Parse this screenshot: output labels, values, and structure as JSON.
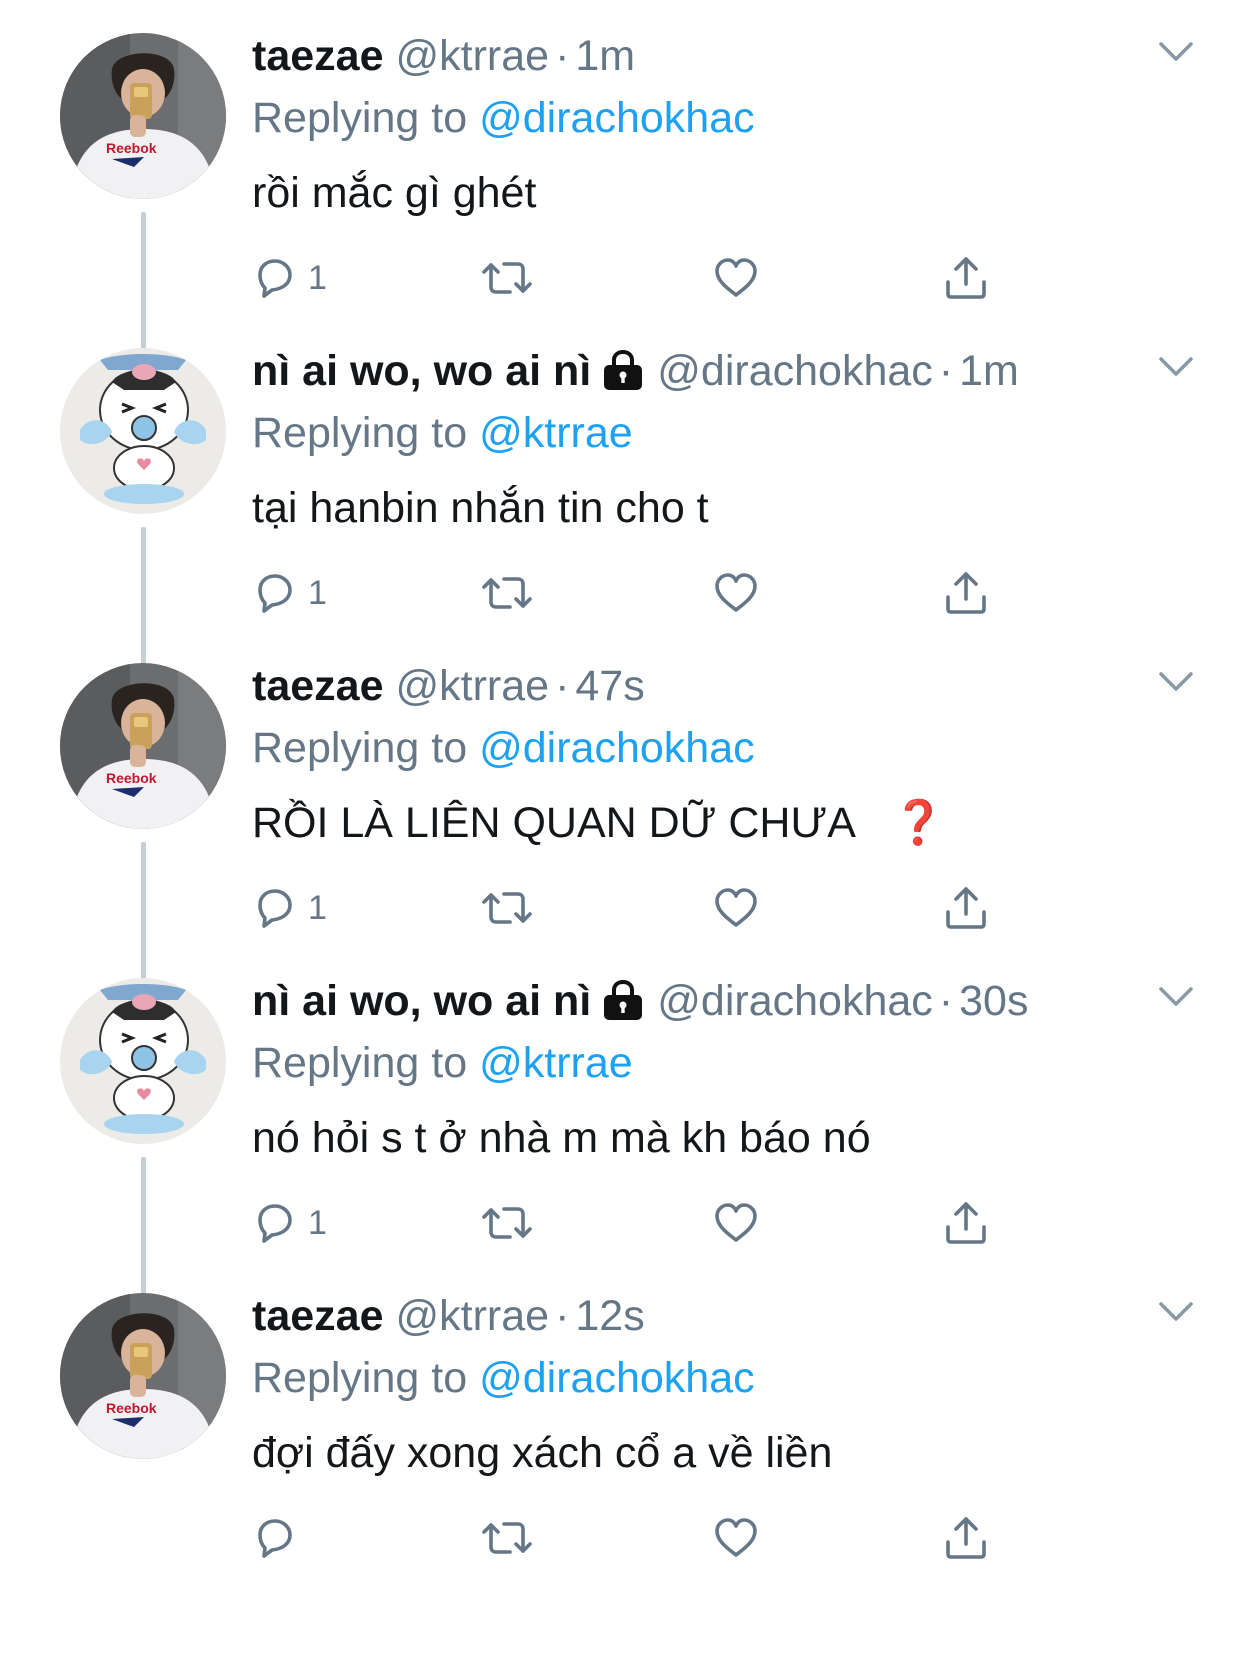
{
  "tweets": [
    {
      "avatar": "selfie-avatar",
      "name": "taezae",
      "locked": false,
      "handle": "@ktrrae",
      "time": "1m",
      "replying_label": "Replying to",
      "replying_to": "@dirachokhac",
      "text": "rồi mắc gì ghét",
      "reply_count": "1"
    },
    {
      "avatar": "cartoon-avatar",
      "name": "nì ai wo, wo ai nì",
      "locked": true,
      "handle": "@dirachokhac",
      "time": "1m",
      "replying_label": "Replying to",
      "replying_to": "@ktrrae",
      "text": "tại hanbin nhắn tin cho t",
      "reply_count": "1"
    },
    {
      "avatar": "selfie-avatar",
      "name": "taezae",
      "locked": false,
      "handle": "@ktrrae",
      "time": "47s",
      "replying_label": "Replying to",
      "replying_to": "@dirachokhac",
      "text": "RỒI LÀ LIÊN QUAN DỮ CHƯA",
      "emoji": "❓",
      "reply_count": "1"
    },
    {
      "avatar": "cartoon-avatar",
      "name": "nì ai wo, wo ai nì",
      "locked": true,
      "handle": "@dirachokhac",
      "time": "30s",
      "replying_label": "Replying to",
      "replying_to": "@ktrrae",
      "text": "nó hỏi s t ở nhà m mà kh báo nó",
      "reply_count": "1"
    },
    {
      "avatar": "selfie-avatar",
      "name": "taezae",
      "locked": false,
      "handle": "@ktrrae",
      "time": "12s",
      "replying_label": "Replying to",
      "replying_to": "@dirachokhac",
      "text": "đợi đấy xong xách cổ a về liền",
      "reply_count": ""
    }
  ],
  "separator": "·",
  "icons": [
    "reply-icon",
    "retweet-icon",
    "like-icon",
    "share-icon",
    "chevron-down-icon",
    "lock-icon"
  ],
  "colors": {
    "text": "#14171a",
    "secondary": "#657786",
    "link": "#1da1f2",
    "thread_line": "#c4cfd6",
    "question_mark": "#d0211b"
  }
}
